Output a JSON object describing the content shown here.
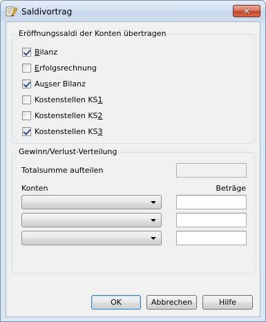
{
  "window": {
    "title": "Saldivortrag",
    "close_symbol": "✕"
  },
  "group_eroeffnung": {
    "legend": "Eröffnungssaldi der Konten übertragen",
    "checkboxes": [
      {
        "pre": "",
        "u": "B",
        "post": "ilanz",
        "checked": true
      },
      {
        "pre": "",
        "u": "E",
        "post": "rfolgsrechnung",
        "checked": false
      },
      {
        "pre": "Au",
        "u": "s",
        "post": "ser Bilanz",
        "checked": true
      },
      {
        "pre": "Kostenstellen KS",
        "u": "1",
        "post": "",
        "checked": false
      },
      {
        "pre": "Kostenstellen KS",
        "u": "2",
        "post": "",
        "checked": false
      },
      {
        "pre": "Kostenstellen KS",
        "u": "3",
        "post": "",
        "checked": true
      }
    ]
  },
  "group_gewinn": {
    "legend": "Gewinn/Verlust-Verteilung",
    "totalsumme_label": "Totalsumme aufteilen",
    "totalsumme_value": "",
    "konten_header": "Konten",
    "betraege_header": "Beträge",
    "rows": [
      {
        "konto": "",
        "betrag": ""
      },
      {
        "konto": "",
        "betrag": ""
      },
      {
        "konto": "",
        "betrag": ""
      }
    ]
  },
  "buttons": {
    "ok": "OK",
    "abbrechen": "Abbrechen",
    "hilfe": "Hilfe"
  },
  "colors": {
    "close_red": "#c0452b",
    "default_button_border": "#3c7fb1"
  }
}
